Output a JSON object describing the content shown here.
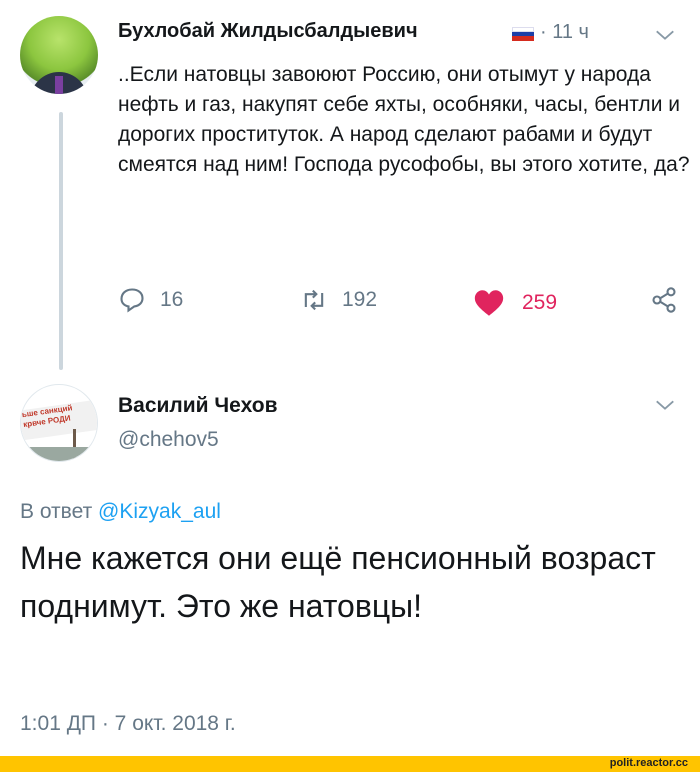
{
  "tweet1": {
    "author_name": "Бухлобай Жилдысбалдыевич",
    "separator": "·",
    "time_ago": "11 ч",
    "text": "..Если натовцы  завоюют Россию, они отымут у народа нефть и газ, накупят себе яхты, особняки, часы, бентли и дорогих проституток. А народ сделают рабами и будут смеятся над ним! Господа русофобы, вы этого хотите, да?",
    "replies": "16",
    "retweets": "192",
    "likes": "259",
    "flag_colors": [
      "#ffffff",
      "#1c3fa8",
      "#d52b1e"
    ],
    "like_color": "#e0245e"
  },
  "tweet2": {
    "author_name": "Василий Чехов",
    "handle": "@chehov5",
    "reply_prefix": "В ответ",
    "reply_mention": "@Kizyak_aul",
    "text": "Мне кажется они ещё пенсионный возраст поднимут. Это же натовцы!",
    "timestamp": "1:01 ДП · 7 окт. 2018 г.",
    "avatar_sign_line1": "ьше санкций",
    "avatar_sign_line2": "крвче РОДИ"
  },
  "icons": [
    "reply-icon",
    "retweet-icon",
    "heart-icon",
    "share-icon",
    "chevron-down-icon"
  ],
  "colors": {
    "text": "#14171a",
    "secondary": "#657786",
    "link": "#1da1f2",
    "footer": "#ffc400"
  },
  "footer": {
    "watermark": "polit.reactor.cc"
  }
}
